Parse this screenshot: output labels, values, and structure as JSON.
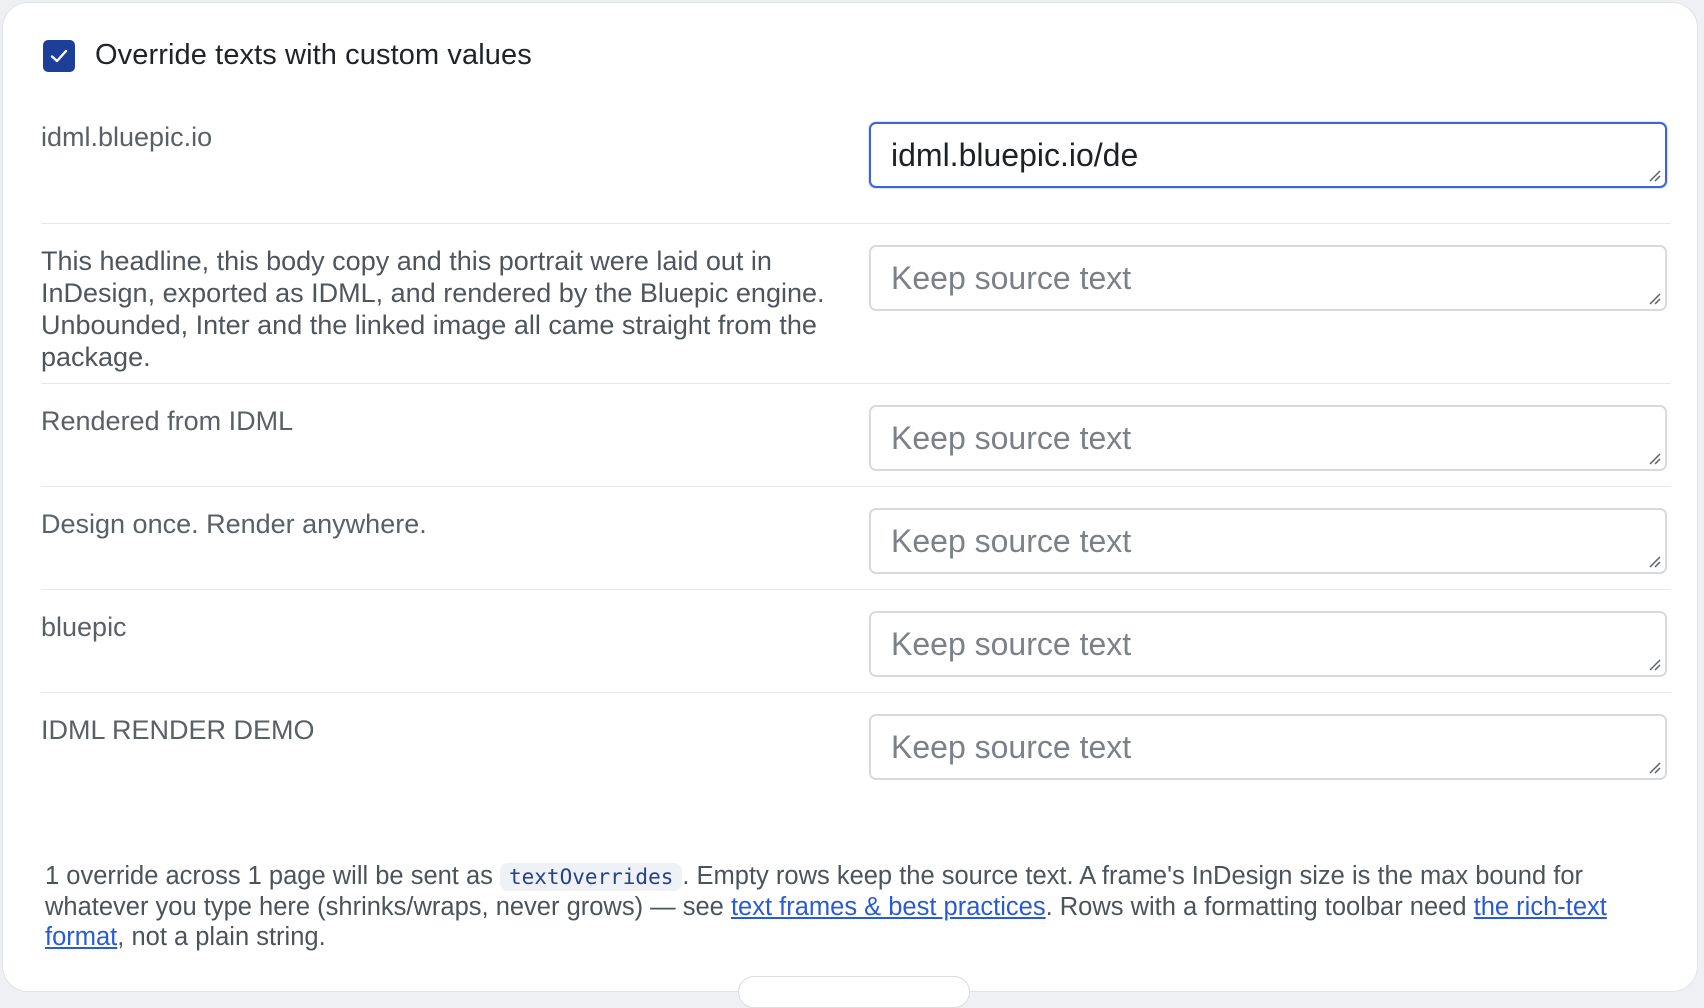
{
  "override": {
    "label": "Override texts with custom values",
    "checked": true,
    "color": "#1d3f9a"
  },
  "rows": [
    {
      "label": "idml.bluepic.io",
      "value": "idml.bluepic.io/de",
      "placeholder": "Keep source text"
    },
    {
      "label": "This headline, this body copy and this portrait were laid out in InDesign, exported as IDML, and rendered by the Bluepic engine. Unbounded, Inter and the linked image all came straight from the package.",
      "value": "",
      "placeholder": "Keep source text"
    },
    {
      "label": "Rendered from IDML",
      "value": "",
      "placeholder": "Keep source text"
    },
    {
      "label": "Design once. Render anywhere.",
      "value": "",
      "placeholder": "Keep source text"
    },
    {
      "label": "bluepic",
      "value": "",
      "placeholder": "Keep source text"
    },
    {
      "label": "IDML RENDER DEMO",
      "value": "",
      "placeholder": "Keep source text"
    }
  ],
  "footnote": {
    "part1": "1 override across 1 page will be sent as ",
    "code": "textOverrides",
    "part2": ". Empty rows keep the source text. A frame's InDesign size is the max bound for whatever you type here (shrinks/wraps, never grows) — see ",
    "link1": "text frames & best practices",
    "part3": ". Rows with a formatting toolbar need ",
    "link2": "the rich-text format",
    "part4": ", not a plain string."
  },
  "colors": {
    "accent": "#1d3f9a",
    "focus_border": "#3f63d8",
    "link": "#2a5bd7"
  }
}
